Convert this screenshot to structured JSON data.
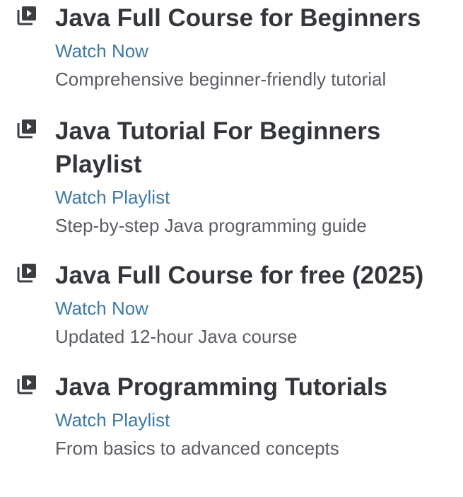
{
  "resources": [
    {
      "icon": "video-playlist-icon",
      "title": "Java Full Course for Beginners",
      "link_label": "Watch Now",
      "description": "Comprehensive beginner-friendly tutorial"
    },
    {
      "icon": "video-playlist-icon",
      "title": "Java Tutorial For Beginners Playlist",
      "link_label": "Watch Playlist",
      "description": "Step-by-step Java programming guide"
    },
    {
      "icon": "video-playlist-icon",
      "title": "Java Full Course for free (2025)",
      "link_label": "Watch Now",
      "description": "Updated 12-hour Java course"
    },
    {
      "icon": "video-playlist-icon",
      "title": "Java Programming Tutorials",
      "link_label": "Watch Playlist",
      "description": "From basics to advanced concepts"
    }
  ],
  "colors": {
    "title": "#33363b",
    "link": "#3e7aa6",
    "description": "#595d63",
    "icon": "#3a3d42"
  }
}
